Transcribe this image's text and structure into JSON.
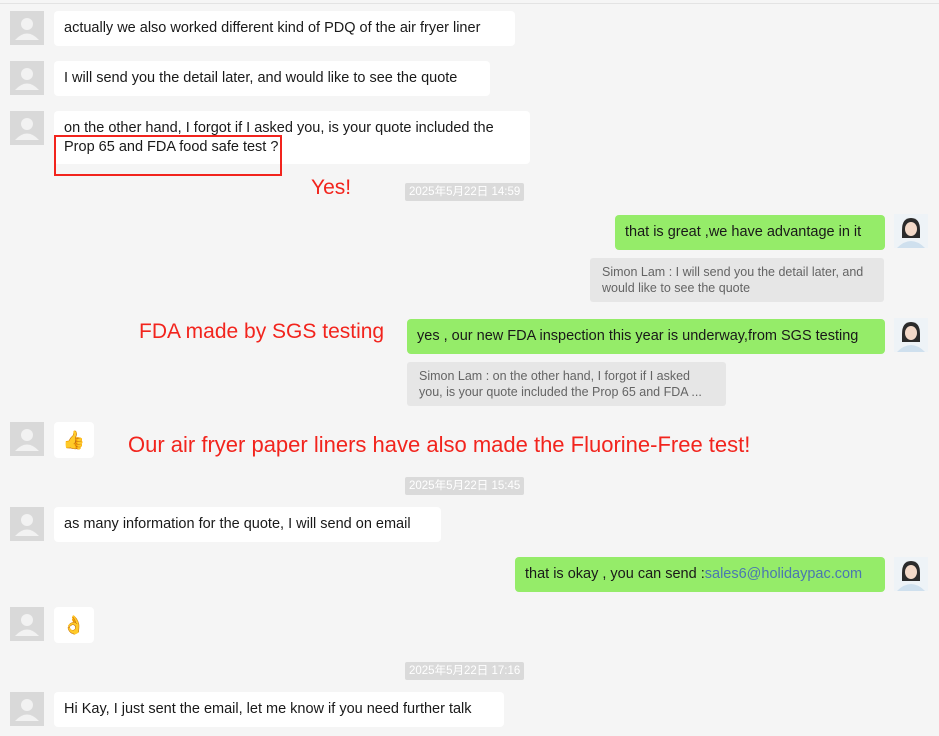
{
  "messages": {
    "m1": "actually we also worked different kind of PDQ of the air fryer liner",
    "m2": "I will send you the detail later, and would like to see the quote",
    "m3_line1": "on the other hand, I forgot if I asked you, is your quote included the",
    "m3_line2": "Prop 65 and FDA food safe test",
    "m3_tail": "?",
    "m4": "that is great ,we have advantage in it",
    "m4_quote": "Simon Lam : I will send you the detail later, and would like to see the quote",
    "m5": "yes , our new FDA inspection this year is underway,from SGS testing",
    "m5_quote": "Simon Lam : on the other hand, I forgot if I asked you, is your quote included the Prop 65 and FDA ...",
    "m6_emoji": "👍",
    "m7": "as many information for the quote, I will send on email",
    "m8_prefix": "that is okay , you can send : ",
    "m8_email": "sales6@holidaypac.com",
    "m9_emoji": "👌",
    "m10": "Hi Kay, I just sent the email, let me know if you need further talk"
  },
  "timestamps": {
    "t1": "2025年5月22日 14:59",
    "t2": "2025年5月22日 15:45",
    "t3": "2025年5月22日 17:16"
  },
  "annotations": {
    "a1": "Yes!",
    "a2": "FDA made by SGS testing",
    "a3": "Our air fryer paper liners have also made the Fluorine-Free test!"
  },
  "colors": {
    "sent_bubble": "#95ec69",
    "received_bubble": "#ffffff",
    "annotation_red": "#f2241d",
    "email_link": "#4a77b0"
  },
  "icons": {
    "contact_avatar": "person-icon",
    "my_avatar": "user-photo"
  }
}
